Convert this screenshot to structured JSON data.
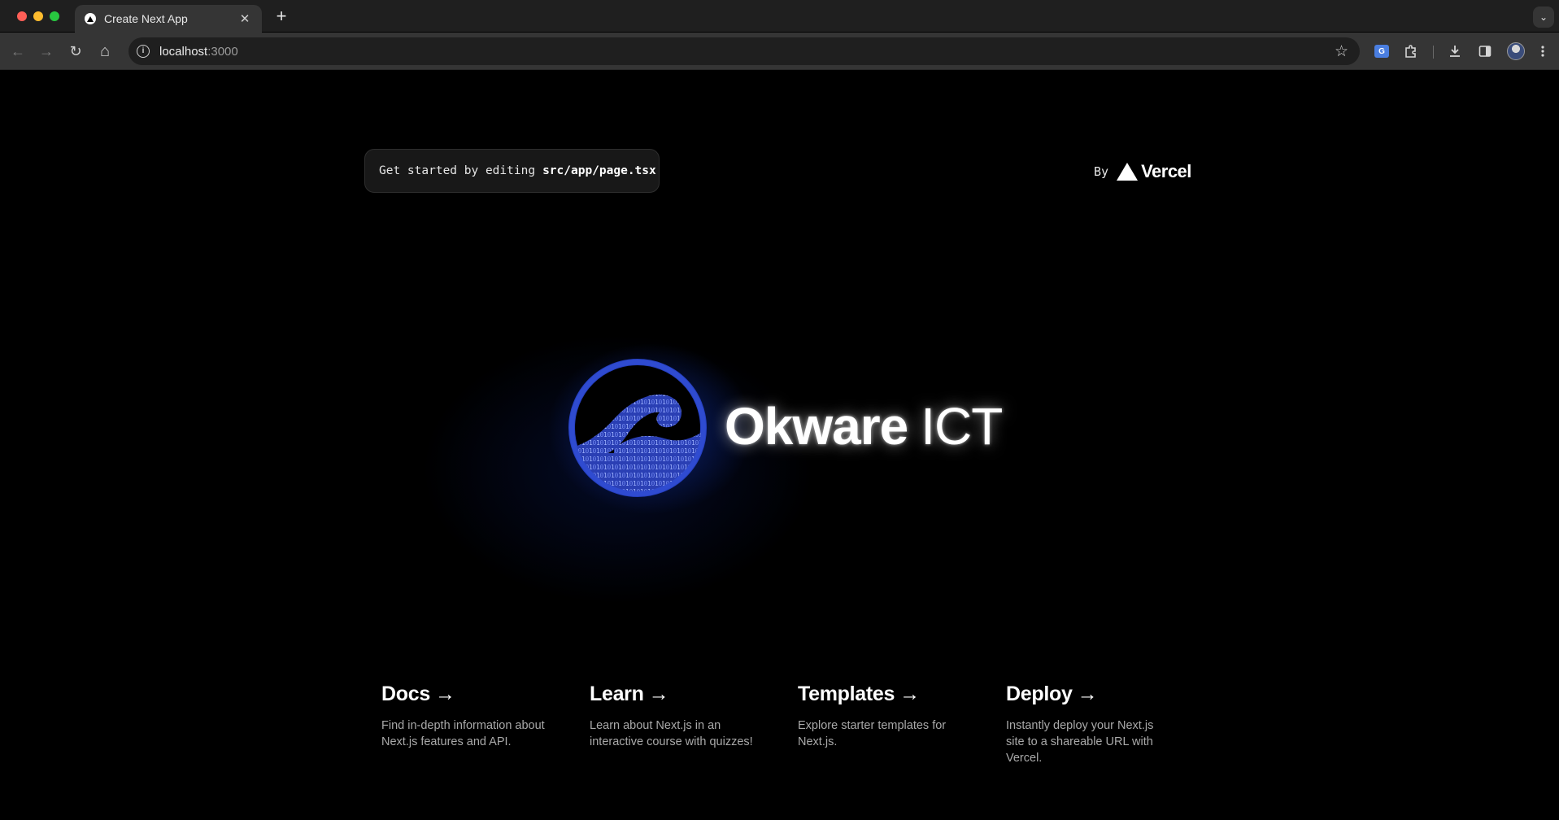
{
  "browser": {
    "tab": {
      "title": "Create Next App",
      "close": "✕"
    },
    "new_tab": "+",
    "tab_menu": "⌄",
    "url": {
      "host": "localhost",
      "port": ":3000"
    },
    "nav": {
      "back": "←",
      "forward": "→",
      "reload": "↻",
      "home": "⌂"
    },
    "star": "☆",
    "toolbar_icons": [
      "translate-icon",
      "extensions-icon",
      "download-icon",
      "sidebar-icon",
      "profile-avatar",
      "more-icon"
    ]
  },
  "page": {
    "edit_hint": {
      "prefix": "Get started by editing",
      "file": "src/app/page.tsx"
    },
    "by": {
      "label": "By",
      "brand": "Vercel"
    },
    "logo": {
      "primary": "Okware",
      "secondary": "ICT",
      "accent": "#2540b8",
      "binary": "1011010 0110 1001 11 010 1101 0010 11 01101 0110 1001"
    },
    "cards": [
      {
        "title": "Docs",
        "arrow": "→",
        "desc": "Find in-depth information about Next.js features and API."
      },
      {
        "title": "Learn",
        "arrow": "→",
        "desc": "Learn about Next.js in an interactive course with quizzes!"
      },
      {
        "title": "Templates",
        "arrow": "→",
        "desc": "Explore starter templates for Next.js."
      },
      {
        "title": "Deploy",
        "arrow": "→",
        "desc": "Instantly deploy your Next.js site to a shareable URL with Vercel."
      }
    ]
  }
}
